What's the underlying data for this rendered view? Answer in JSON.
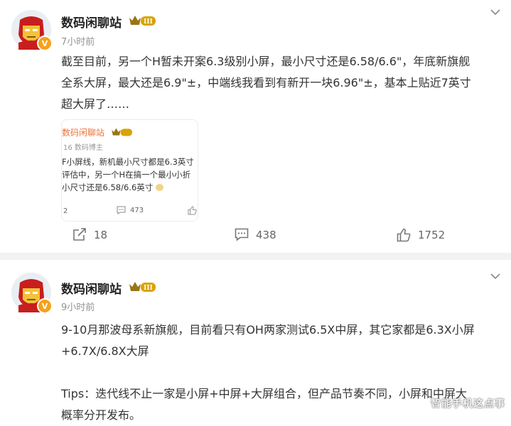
{
  "posts": [
    {
      "username": "数码闲聊站",
      "level_badge": "III",
      "time": "7小时前",
      "text_lines": [
        "截至目前，另一个H暂未开案6.3级别小屏，最小尺寸还是6.58/6.6\"，年底新旗舰",
        "全系大屏，最大还是6.9\"±，中端线我看到有新开一块6.96\"±，基本上贴近7英寸",
        "超大屏了……"
      ],
      "quote": {
        "username": "数码闲聊站",
        "meta": "16  数码博主",
        "text_lines": [
          "F小屏线，新机最小尺寸都是6.3英寸",
          "评估中，另一个H在搞一个最小小折",
          "小尺寸还是6.58/6.6英寸"
        ],
        "repost_count": "2",
        "comment_count": "473"
      },
      "repost_count": "18",
      "comment_count": "438",
      "like_count": "1752"
    },
    {
      "username": "数码闲聊站",
      "level_badge": "III",
      "time": "9小时前",
      "text_lines": [
        "9-10月那波母系新旗舰，目前看只有OH两家测试6.5X中屏，其它家都是6.3X小屏",
        "+6.7X/6.8X大屏",
        "",
        "Tips：迭代线不止一家是小屏+中屏+大屏组合，但产品节奏不同，小屏和中屏大",
        "概率分开发布。"
      ]
    }
  ],
  "watermark": "智能手机这点事",
  "colors": {
    "brand_orange": "#e9733a",
    "badge_gold": "#f7a11a",
    "text_primary": "#333333",
    "text_secondary": "#939393"
  },
  "icons": {
    "avatar": "iron-man-avatar",
    "verify": "verified-badge-icon",
    "menu": "chevron-down-icon",
    "repost": "repost-icon",
    "comment": "comment-icon",
    "like": "like-icon"
  }
}
